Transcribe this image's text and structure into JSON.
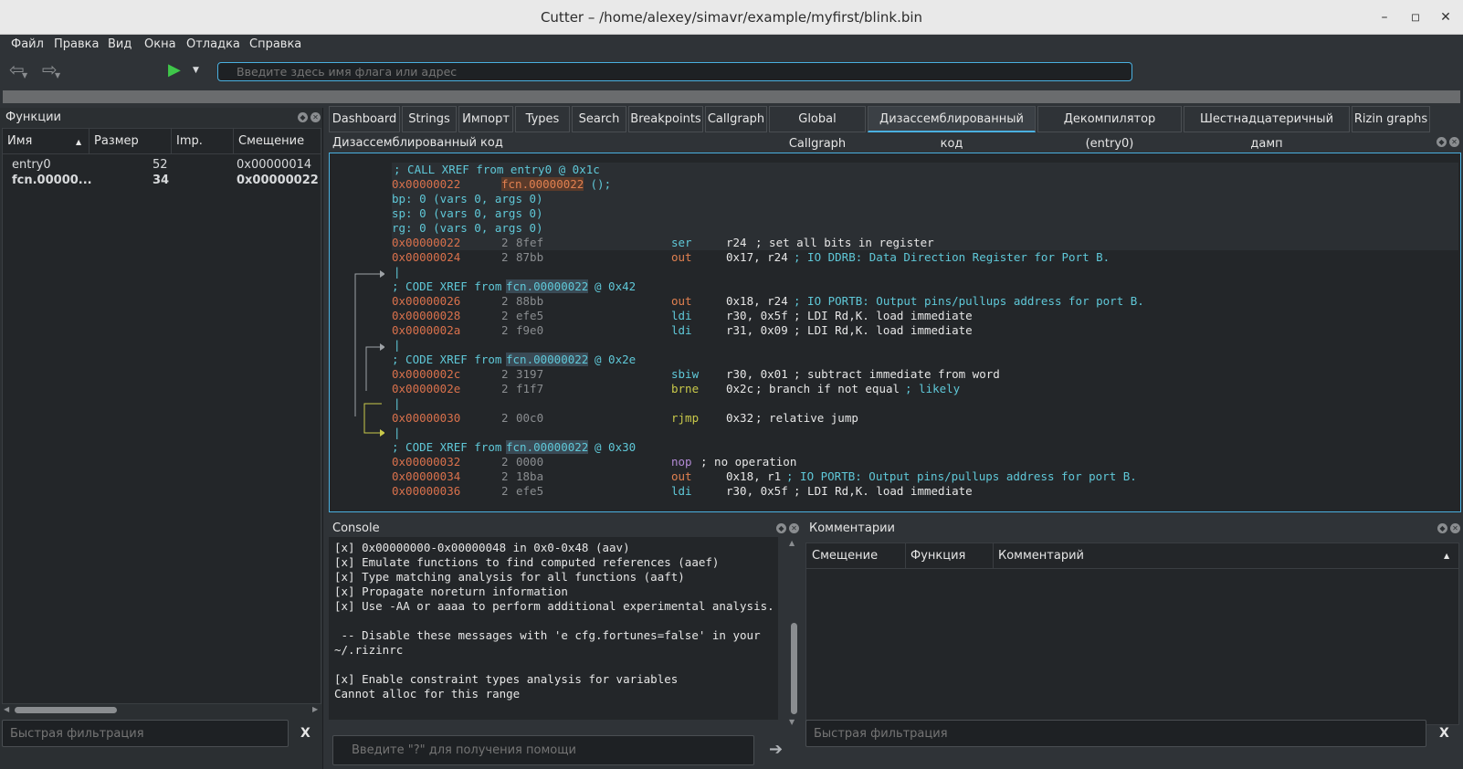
{
  "window": {
    "title": "Cutter – /home/alexey/simavr/example/myfirst/blink.bin"
  },
  "menu": [
    "Файл",
    "Правка",
    "Вид",
    "Окна",
    "Отладка",
    "Справка"
  ],
  "toolbar": {
    "search_placeholder": "Введите здесь имя флага или адрес"
  },
  "functions_panel": {
    "title": "Функции",
    "columns": [
      "Имя",
      "Размер",
      "Imp.",
      "Смещение"
    ],
    "rows": [
      {
        "name": "entry0",
        "size": "52",
        "imp": "",
        "offset": "0x00000014"
      },
      {
        "name": "fcn.00000...",
        "size": "34",
        "imp": "",
        "offset": "0x00000022"
      }
    ],
    "filter_placeholder": "Быстрая фильтрация",
    "filter_clear": "X"
  },
  "tabs": [
    "Dashboard",
    "Strings",
    "Импорт",
    "Types",
    "Search",
    "Breakpoints",
    "Callgraph",
    "Global Callgraph",
    "Дизассемблированный код",
    "Декомпилятор (entry0)",
    "Шестнадцатеричный дамп",
    "Rizin graphs"
  ],
  "disasm": {
    "title": "Дизассемблированный код",
    "header_lines": [
      "; CALL XREF from entry0 @ 0x1c",
      "bp: 0 (vars 0, args 0)",
      "sp: 0 (vars 0, args 0)",
      "rg: 0 (vars 0, args 0)"
    ],
    "func_addr": "0x00000022",
    "func_name": "fcn.00000022",
    "func_suffix": " ();",
    "xref_prefix": "; CODE XREF from ",
    "xrefs": [
      "@ 0x42",
      "@ 0x2e",
      "@ 0x30"
    ],
    "pipe": "|",
    "instructions": [
      {
        "addr": "0x00000022",
        "size": "2",
        "bytes": "8fef",
        "mnem": "ser",
        "ops": "r24",
        "comment": "; set all bits in register"
      },
      {
        "addr": "0x00000024",
        "size": "2",
        "bytes": "87bb",
        "mnem": "out",
        "ops": "0x17, r24",
        "comment": "; IO DDRB: Data Direction Register for Port B."
      },
      {
        "addr": "0x00000026",
        "size": "2",
        "bytes": "88bb",
        "mnem": "out",
        "ops": "0x18, r24",
        "comment": "; IO PORTB: Output pins/pullups address for port B."
      },
      {
        "addr": "0x00000028",
        "size": "2",
        "bytes": "efe5",
        "mnem": "ldi",
        "ops": "r30, 0x5f",
        "comment": "; LDI Rd,K. load immediate"
      },
      {
        "addr": "0x0000002a",
        "size": "2",
        "bytes": "f9e0",
        "mnem": "ldi",
        "ops": "r31, 0x09",
        "comment": "; LDI Rd,K. load immediate"
      },
      {
        "addr": "0x0000002c",
        "size": "2",
        "bytes": "3197",
        "mnem": "sbiw",
        "ops": "r30, 0x01",
        "comment": "; subtract immediate from word"
      },
      {
        "addr": "0x0000002e",
        "size": "2",
        "bytes": "f1f7",
        "mnem": "brne",
        "ops": "0x2c",
        "comment": "; branch if not equal",
        "comment2": "; likely"
      },
      {
        "addr": "0x00000030",
        "size": "2",
        "bytes": "00c0",
        "mnem": "rjmp",
        "ops": "0x32",
        "comment": "; relative jump"
      },
      {
        "addr": "0x00000032",
        "size": "2",
        "bytes": "0000",
        "mnem": "nop",
        "ops": "",
        "comment": "; no operation"
      },
      {
        "addr": "0x00000034",
        "size": "2",
        "bytes": "18ba",
        "mnem": "out",
        "ops": "0x18, r1",
        "comment": "; IO PORTB: Output pins/pullups address for port B."
      },
      {
        "addr": "0x00000036",
        "size": "2",
        "bytes": "efe5",
        "mnem": "ldi",
        "ops": "r30, 0x5f",
        "comment": "; LDI Rd,K. load immediate"
      }
    ]
  },
  "console": {
    "title": "Console",
    "lines": [
      "[x] 0x00000000-0x00000048 in 0x0-0x48 (aav)",
      "[x] Emulate functions to find computed references (aaef)",
      "[x] Type matching analysis for all functions (aaft)",
      "[x] Propagate noreturn information",
      "[x] Use -AA or aaaa to perform additional experimental analysis.",
      "",
      " -- Disable these messages with 'e cfg.fortunes=false' in your",
      "~/.rizinrc",
      "",
      "[x] Enable constraint types analysis for variables",
      "Cannot alloc for this range"
    ],
    "input_placeholder": "Введите \"?\" для получения помощи"
  },
  "comments_panel": {
    "title": "Комментарии",
    "columns": [
      "Смещение",
      "Функция",
      "Комментарий"
    ],
    "filter_placeholder": "Быстрая фильтрация",
    "filter_clear": "X"
  },
  "colors": {
    "accent": "#4ab0e0",
    "addr": "#d9714c",
    "cyan": "#5fc8d8",
    "jump": "#c9c94a",
    "background": "#2f3337"
  }
}
